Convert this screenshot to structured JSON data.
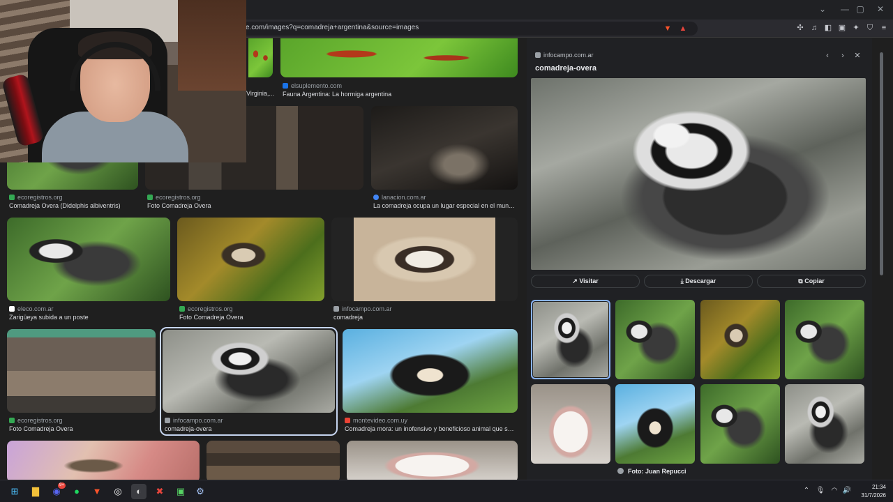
{
  "browser": {
    "url": "e.com/images?q=comadreja+argentina&source=images",
    "window_controls": [
      "⌄",
      "—",
      "▢",
      "✕"
    ]
  },
  "results": [
    {
      "source": "",
      "title": "Virginia,...",
      "fav": "#3c4043"
    },
    {
      "source": "elsuplemento.com",
      "title": "Fauna Argentina: La hormiga argentina",
      "fav": "#1a73e8"
    },
    {
      "source": "ecoregistros.org",
      "title": "Comadreja Overa (Didelphis albiventris)",
      "fav": "#34a853"
    },
    {
      "source": "ecoregistros.org",
      "title": "Foto Comadreja Overa",
      "fav": "#34a853"
    },
    {
      "source": "lanacion.com.ar",
      "title": "La comadreja ocupa un lugar especial en el mundo e...",
      "fav": "#4285f4"
    },
    {
      "source": "eleco.com.ar",
      "title": "Zarigüeya subida a un poste",
      "fav": "#ffffff"
    },
    {
      "source": "ecoregistros.org",
      "title": "Foto Comadreja Overa",
      "fav": "#34a853"
    },
    {
      "source": "infocampo.com.ar",
      "title": "comadreja",
      "fav": "#9aa0a6"
    },
    {
      "source": "ecoregistros.org",
      "title": "Foto Comadreja Overa",
      "fav": "#34a853"
    },
    {
      "source": "infocampo.com.ar",
      "title": "comadreja-overa",
      "fav": "#9aa0a6"
    },
    {
      "source": "montevideo.com.uy",
      "title": "Comadreja mora: un inofensivo y beneficioso animal que se ad...",
      "fav": "#ea4335"
    }
  ],
  "panel": {
    "source": "infocampo.com.ar",
    "title": "comadreja-overa",
    "visit": "Visitar",
    "download": "Descargar",
    "copy": "Copiar",
    "credit": "Foto: Juan Repucci"
  },
  "taskbar": {
    "time": "21:34",
    "date": "31/7/2026",
    "discord_badge": "9+"
  }
}
